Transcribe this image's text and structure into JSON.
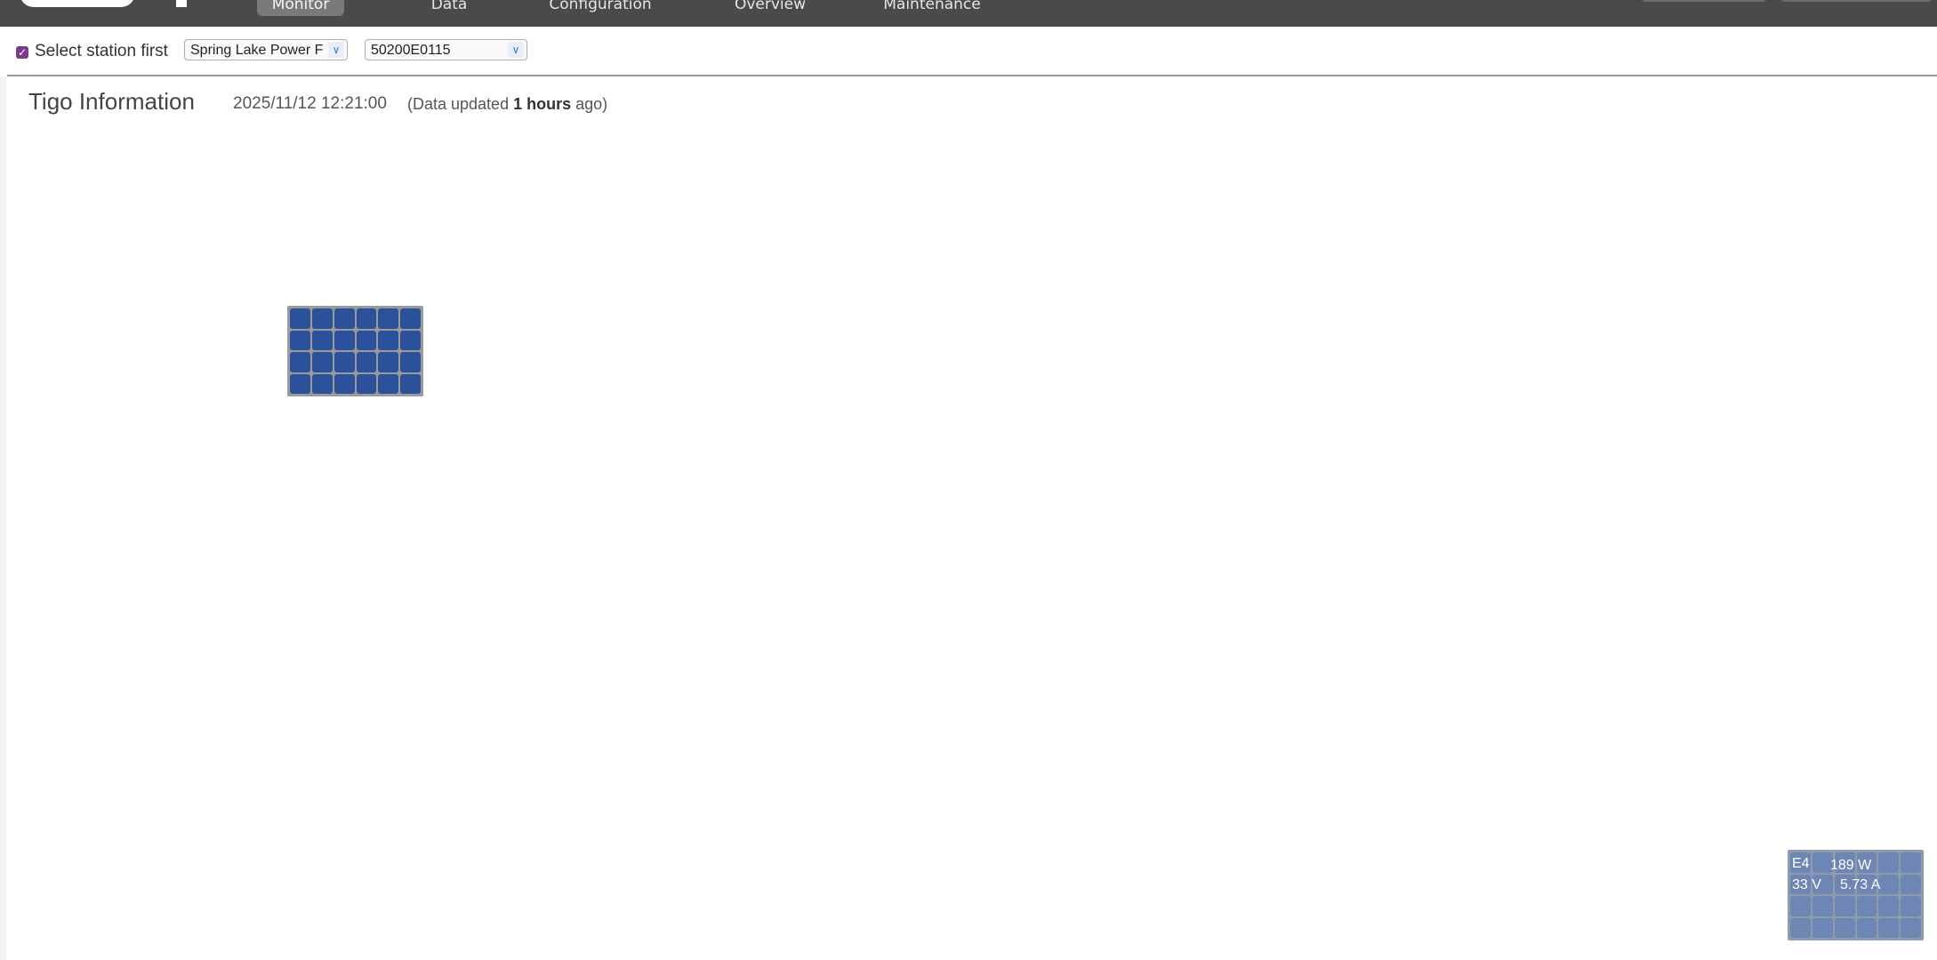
{
  "nav": {
    "tabs": [
      {
        "label": "Monitor",
        "active": true
      },
      {
        "label": "Data",
        "active": false
      },
      {
        "label": "Configuration",
        "active": false
      },
      {
        "label": "Overview",
        "active": false
      },
      {
        "label": "Maintenance",
        "active": false
      }
    ]
  },
  "filters": {
    "select_station_first_label": "Select station first",
    "select_station_first_checked": true,
    "station_select_value": "Spring Lake Power F",
    "device_select_value": "50200E0115"
  },
  "page": {
    "title": "Tigo Information",
    "timestamp": "2025/11/12 12:21:00",
    "update_prefix": "(Data updated",
    "update_value": "1 hours",
    "update_suffix": "ago)"
  },
  "panels": {
    "e4": {
      "id": "E4",
      "power": "189 W",
      "voltage": "33 V",
      "current": "5.73 A"
    }
  },
  "colors": {
    "topbar": "#4a4a4a",
    "checkbox_accent": "#7b3a8b",
    "panel_cell": "#2a519a",
    "panel_frame": "#9a9a9a"
  }
}
